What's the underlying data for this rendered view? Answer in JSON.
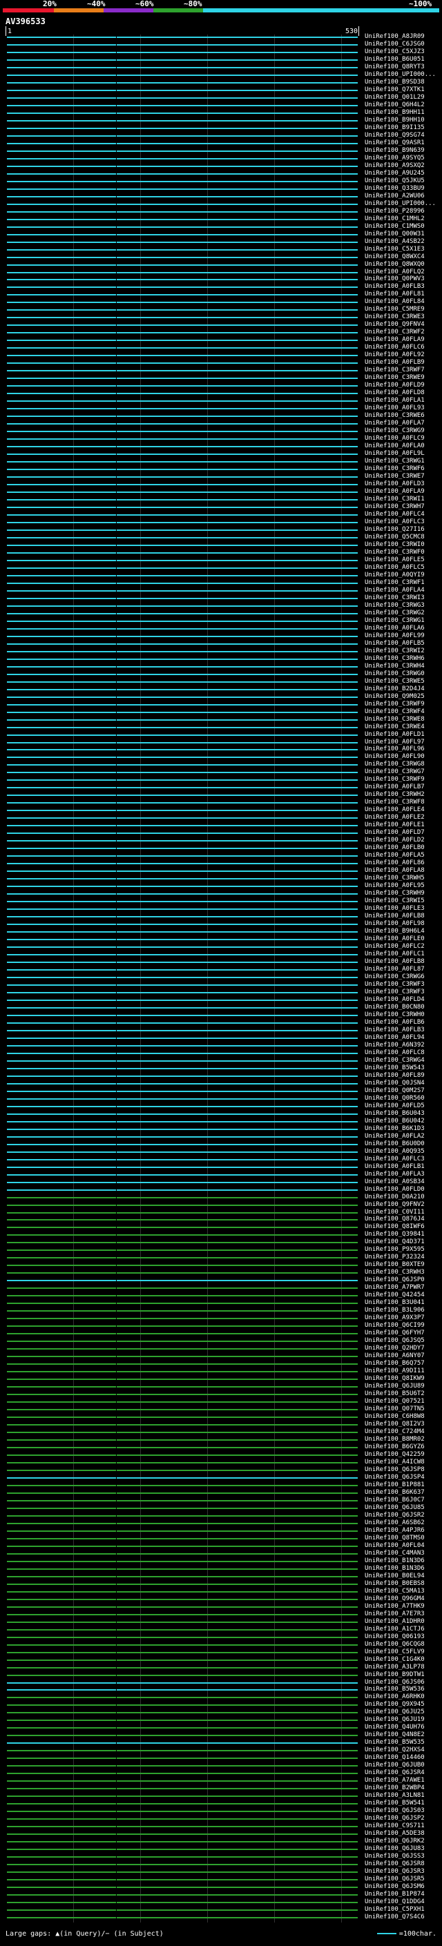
{
  "legend": {
    "thresholds": [
      "20%",
      "~40%",
      "~60%",
      "~80%",
      "~100%"
    ],
    "colors": [
      "#e8172e",
      "#e87e1a",
      "#8a2bc9",
      "#2ea22e",
      "#2fd4e6"
    ]
  },
  "query_id": "AV396533",
  "ruler": {
    "start": "1",
    "end": "530"
  },
  "colors": {
    "cyan": "#2fd4e6",
    "green": "#2ea22e",
    "background": "#000000"
  },
  "hits": [
    {
      "label": "UniRef100_A8JR09",
      "color": "cyan"
    },
    {
      "label": "UniRef100_C6JSG0",
      "color": "cyan"
    },
    {
      "label": "UniRef100_C5XJZ3",
      "color": "cyan"
    },
    {
      "label": "UniRef100_B6U051",
      "color": "cyan"
    },
    {
      "label": "UniRef100_Q8RYT3",
      "color": "cyan"
    },
    {
      "label": "UniRef100_UPI000...",
      "color": "cyan"
    },
    {
      "label": "UniRef100_B9SD38",
      "color": "cyan"
    },
    {
      "label": "UniRef100_Q7XTK1",
      "color": "cyan"
    },
    {
      "label": "UniRef100_Q01L29",
      "color": "cyan"
    },
    {
      "label": "UniRef100_Q6H4L2",
      "color": "cyan"
    },
    {
      "label": "UniRef100_B9HH11",
      "color": "cyan"
    },
    {
      "label": "UniRef100_B9HH10",
      "color": "cyan"
    },
    {
      "label": "UniRef100_B9I135",
      "color": "cyan"
    },
    {
      "label": "UniRef100_Q9SG74",
      "color": "cyan"
    },
    {
      "label": "UniRef100_Q9ASR1",
      "color": "cyan"
    },
    {
      "label": "UniRef100_B9N639",
      "color": "cyan"
    },
    {
      "label": "UniRef100_A9SYQ5",
      "color": "cyan"
    },
    {
      "label": "UniRef100_A9SXQ2",
      "color": "cyan"
    },
    {
      "label": "UniRef100_A9U245",
      "color": "cyan"
    },
    {
      "label": "UniRef100_Q5JKU5",
      "color": "cyan"
    },
    {
      "label": "UniRef100_Q33BU9",
      "color": "cyan"
    },
    {
      "label": "UniRef100_A2WU06",
      "color": "cyan"
    },
    {
      "label": "UniRef100_UPI000...",
      "color": "cyan"
    },
    {
      "label": "UniRef100_P28996",
      "color": "cyan"
    },
    {
      "label": "UniRef100_C1MHL2",
      "color": "cyan"
    },
    {
      "label": "UniRef100_C1MWS0",
      "color": "cyan"
    },
    {
      "label": "UniRef100_Q00W31",
      "color": "cyan"
    },
    {
      "label": "UniRef100_A4SB22",
      "color": "cyan"
    },
    {
      "label": "UniRef100_C5X1E3",
      "color": "cyan"
    },
    {
      "label": "UniRef100_Q8WXC4",
      "color": "cyan"
    },
    {
      "label": "UniRef100_Q8WXQ0",
      "color": "cyan"
    },
    {
      "label": "UniRef100_A0FLQ2",
      "color": "cyan"
    },
    {
      "label": "UniRef100_Q0PWV3",
      "color": "cyan"
    },
    {
      "label": "UniRef100_A0FLB3",
      "color": "cyan"
    },
    {
      "label": "UniRef100_A0FL81",
      "color": "cyan"
    },
    {
      "label": "UniRef100_A0FL84",
      "color": "cyan"
    },
    {
      "label": "UniRef100_C5MRE9",
      "color": "cyan"
    },
    {
      "label": "UniRef100_C3RWE3",
      "color": "cyan"
    },
    {
      "label": "UniRef100_Q9FNV4",
      "color": "cyan"
    },
    {
      "label": "UniRef100_C3RWF2",
      "color": "cyan"
    },
    {
      "label": "UniRef100_A0FLA9",
      "color": "cyan"
    },
    {
      "label": "UniRef100_A0FLC6",
      "color": "cyan"
    },
    {
      "label": "UniRef100_A0FL92",
      "color": "cyan"
    },
    {
      "label": "UniRef100_A0FLB9",
      "color": "cyan"
    },
    {
      "label": "UniRef100_C3RWF7",
      "color": "cyan"
    },
    {
      "label": "UniRef100_C3RWE9",
      "color": "cyan"
    },
    {
      "label": "UniRef100_A0FLD9",
      "color": "cyan"
    },
    {
      "label": "UniRef100_A0FLD8",
      "color": "cyan"
    },
    {
      "label": "UniRef100_A0FLA1",
      "color": "cyan"
    },
    {
      "label": "UniRef100_A0FL93",
      "color": "cyan"
    },
    {
      "label": "UniRef100_C3RWE6",
      "color": "cyan"
    },
    {
      "label": "UniRef100_A0FLA7",
      "color": "cyan"
    },
    {
      "label": "UniRef100_C3RWG9",
      "color": "cyan"
    },
    {
      "label": "UniRef100_A0FLC9",
      "color": "cyan"
    },
    {
      "label": "UniRef100_A0FLA0",
      "color": "cyan"
    },
    {
      "label": "UniRef100_A0FL9L",
      "color": "cyan"
    },
    {
      "label": "UniRef100_C3RWG1",
      "color": "cyan"
    },
    {
      "label": "UniRef100_C3RWF6",
      "color": "cyan"
    },
    {
      "label": "UniRef100_C3RWE7",
      "color": "cyan"
    },
    {
      "label": "UniRef100_A0FLD3",
      "color": "cyan"
    },
    {
      "label": "UniRef100_A0FLA9",
      "color": "cyan"
    },
    {
      "label": "UniRef100_C3RWI1",
      "color": "cyan"
    },
    {
      "label": "UniRef100_C3RWH7",
      "color": "cyan"
    },
    {
      "label": "UniRef100_A0FLC4",
      "color": "cyan"
    },
    {
      "label": "UniRef100_A0FLC3",
      "color": "cyan"
    },
    {
      "label": "UniRef100_Q27I16",
      "color": "cyan"
    },
    {
      "label": "UniRef100_Q5CMC8",
      "color": "cyan"
    },
    {
      "label": "UniRef100_C3RWI0",
      "color": "cyan"
    },
    {
      "label": "UniRef100_C3RWF0",
      "color": "cyan"
    },
    {
      "label": "UniRef100_A0FLE5",
      "color": "cyan"
    },
    {
      "label": "UniRef100_A0FLC5",
      "color": "cyan"
    },
    {
      "label": "UniRef100_A0QYI9",
      "color": "cyan"
    },
    {
      "label": "UniRef100_C3RWF1",
      "color": "cyan"
    },
    {
      "label": "UniRef100_A0FLA4",
      "color": "cyan"
    },
    {
      "label": "UniRef100_C3RWI3",
      "color": "cyan"
    },
    {
      "label": "UniRef100_C3RWG3",
      "color": "cyan"
    },
    {
      "label": "UniRef100_C3RWG2",
      "color": "cyan"
    },
    {
      "label": "UniRef100_C3RWG1",
      "color": "cyan"
    },
    {
      "label": "UniRef100_A0FLA6",
      "color": "cyan"
    },
    {
      "label": "UniRef100_A0FL99",
      "color": "cyan"
    },
    {
      "label": "UniRef100_A0FLB5",
      "color": "cyan"
    },
    {
      "label": "UniRef100_C3RWI2",
      "color": "cyan"
    },
    {
      "label": "UniRef100_C3RWH6",
      "color": "cyan"
    },
    {
      "label": "UniRef100_C3RWH4",
      "color": "cyan"
    },
    {
      "label": "UniRef100_C3RWG0",
      "color": "cyan"
    },
    {
      "label": "UniRef100_C3RWE5",
      "color": "cyan"
    },
    {
      "label": "UniRef100_B2D4J4",
      "color": "cyan"
    },
    {
      "label": "UniRef100_Q9M025",
      "color": "cyan"
    },
    {
      "label": "UniRef100_C3RWF9",
      "color": "cyan"
    },
    {
      "label": "UniRef100_C3RWF4",
      "color": "cyan"
    },
    {
      "label": "UniRef100_C3RWE8",
      "color": "cyan"
    },
    {
      "label": "UniRef100_C3RWE4",
      "color": "cyan"
    },
    {
      "label": "UniRef100_A0FLD1",
      "color": "cyan"
    },
    {
      "label": "UniRef100_A0FL97",
      "color": "cyan"
    },
    {
      "label": "UniRef100_A0FL96",
      "color": "cyan"
    },
    {
      "label": "UniRef100_A0FL90",
      "color": "cyan"
    },
    {
      "label": "UniRef100_C3RWG8",
      "color": "cyan"
    },
    {
      "label": "UniRef100_C3RWG7",
      "color": "cyan"
    },
    {
      "label": "UniRef100_C3RWF9",
      "color": "cyan"
    },
    {
      "label": "UniRef100_A0FLB7",
      "color": "cyan"
    },
    {
      "label": "UniRef100_C3RWH2",
      "color": "cyan"
    },
    {
      "label": "UniRef100_C3RWF8",
      "color": "cyan"
    },
    {
      "label": "UniRef100_A0FLE4",
      "color": "cyan"
    },
    {
      "label": "UniRef100_A0FLE2",
      "color": "cyan"
    },
    {
      "label": "UniRef100_A0FLE1",
      "color": "cyan"
    },
    {
      "label": "UniRef100_A0FLD7",
      "color": "cyan"
    },
    {
      "label": "UniRef100_A0FLD2",
      "color": "cyan"
    },
    {
      "label": "UniRef100_A0FLB0",
      "color": "cyan"
    },
    {
      "label": "UniRef100_A0FLA5",
      "color": "cyan"
    },
    {
      "label": "UniRef100_A0FL86",
      "color": "cyan"
    },
    {
      "label": "UniRef100_A0FLA8",
      "color": "cyan"
    },
    {
      "label": "UniRef100_C3RWH5",
      "color": "cyan"
    },
    {
      "label": "UniRef100_A0FL95",
      "color": "cyan"
    },
    {
      "label": "UniRef100_C3RWH9",
      "color": "cyan"
    },
    {
      "label": "UniRef100_C3RWI5",
      "color": "cyan"
    },
    {
      "label": "UniRef100_A0FLE3",
      "color": "cyan"
    },
    {
      "label": "UniRef100_A0FLB8",
      "color": "cyan"
    },
    {
      "label": "UniRef100_A0FL98",
      "color": "cyan"
    },
    {
      "label": "UniRef100_B9H6L4",
      "color": "cyan"
    },
    {
      "label": "UniRef100_A0FLE0",
      "color": "cyan"
    },
    {
      "label": "UniRef100_A0FLC2",
      "color": "cyan"
    },
    {
      "label": "UniRef100_A0FLC1",
      "color": "cyan"
    },
    {
      "label": "UniRef100_A0FLB8",
      "color": "cyan"
    },
    {
      "label": "UniRef100_A0FL87",
      "color": "cyan"
    },
    {
      "label": "UniRef100_C3RWG6",
      "color": "cyan"
    },
    {
      "label": "UniRef100_C3RWF3",
      "color": "cyan"
    },
    {
      "label": "UniRef100_C3RWF3",
      "color": "cyan"
    },
    {
      "label": "UniRef100_A0FLD4",
      "color": "cyan"
    },
    {
      "label": "UniRef100_B0CN80",
      "color": "cyan"
    },
    {
      "label": "UniRef100_C3RWH0",
      "color": "cyan"
    },
    {
      "label": "UniRef100_A0FLB6",
      "color": "cyan"
    },
    {
      "label": "UniRef100_A0FLB3",
      "color": "cyan"
    },
    {
      "label": "UniRef100_A0FL94",
      "color": "cyan"
    },
    {
      "label": "UniRef100_A6N392",
      "color": "cyan"
    },
    {
      "label": "UniRef100_A0FLC8",
      "color": "cyan"
    },
    {
      "label": "UniRef100_C3RWG4",
      "color": "cyan"
    },
    {
      "label": "UniRef100_B5W543",
      "color": "cyan"
    },
    {
      "label": "UniRef100_A0FL89",
      "color": "cyan"
    },
    {
      "label": "UniRef100_Q0JSN4",
      "color": "cyan"
    },
    {
      "label": "UniRef100_Q0M2S7",
      "color": "cyan"
    },
    {
      "label": "UniRef100_Q0R560",
      "color": "cyan"
    },
    {
      "label": "UniRef100_A0FLD5",
      "color": "cyan"
    },
    {
      "label": "UniRef100_B6U043",
      "color": "cyan"
    },
    {
      "label": "UniRef100_B6U042",
      "color": "cyan"
    },
    {
      "label": "UniRef100_B6K1D3",
      "color": "cyan"
    },
    {
      "label": "UniRef100_A0FLA2",
      "color": "cyan"
    },
    {
      "label": "UniRef100_B6U0D0",
      "color": "cyan"
    },
    {
      "label": "UniRef100_A0Q935",
      "color": "cyan"
    },
    {
      "label": "UniRef100_A0FLC3",
      "color": "cyan"
    },
    {
      "label": "UniRef100_A0FLB1",
      "color": "cyan"
    },
    {
      "label": "UniRef100_A0FLA3",
      "color": "cyan"
    },
    {
      "label": "UniRef100_A0SB34",
      "color": "cyan"
    },
    {
      "label": "UniRef100_A0FLD0",
      "color": "cyan"
    },
    {
      "label": "UniRef100_D0A210",
      "color": "green"
    },
    {
      "label": "UniRef100_Q9FNV2",
      "color": "green"
    },
    {
      "label": "UniRef100_C0VI11",
      "color": "green"
    },
    {
      "label": "UniRef100_Q876J4",
      "color": "green"
    },
    {
      "label": "UniRef100_Q8IWF6",
      "color": "green"
    },
    {
      "label": "UniRef100_Q39841",
      "color": "green"
    },
    {
      "label": "UniRef100_Q4D371",
      "color": "green"
    },
    {
      "label": "UniRef100_P9X595",
      "color": "green"
    },
    {
      "label": "UniRef100_P32324",
      "color": "green"
    },
    {
      "label": "UniRef100_B0XTE9",
      "color": "green"
    },
    {
      "label": "UniRef100_C3RWH3",
      "color": "green"
    },
    {
      "label": "UniRef100_Q6JSP0",
      "color": "cyan"
    },
    {
      "label": "UniRef100_A7PWR7",
      "color": "green"
    },
    {
      "label": "UniRef100_Q42454",
      "color": "green"
    },
    {
      "label": "UniRef100_B3U041",
      "color": "green"
    },
    {
      "label": "UniRef100_B3L906",
      "color": "green"
    },
    {
      "label": "UniRef100_A9X3P7",
      "color": "green"
    },
    {
      "label": "UniRef100_Q6CI99",
      "color": "green"
    },
    {
      "label": "UniRef100_Q6FYH7",
      "color": "green"
    },
    {
      "label": "UniRef100_Q6JSQ5",
      "color": "green"
    },
    {
      "label": "UniRef100_Q2HDY7",
      "color": "green"
    },
    {
      "label": "UniRef100_A6NY07",
      "color": "green"
    },
    {
      "label": "UniRef100_B6Q757",
      "color": "green"
    },
    {
      "label": "UniRef100_A9DI11",
      "color": "green"
    },
    {
      "label": "UniRef100_Q8IKW9",
      "color": "green"
    },
    {
      "label": "UniRef100_Q6JU89",
      "color": "green"
    },
    {
      "label": "UniRef100_B5U6T2",
      "color": "green"
    },
    {
      "label": "UniRef100_Q07521",
      "color": "green"
    },
    {
      "label": "UniRef100_Q07TN5",
      "color": "green"
    },
    {
      "label": "UniRef100_C6H8W8",
      "color": "green"
    },
    {
      "label": "UniRef100_Q8I2V3",
      "color": "green"
    },
    {
      "label": "UniRef100_C724M4",
      "color": "green"
    },
    {
      "label": "UniRef100_B8MR02",
      "color": "green"
    },
    {
      "label": "UniRef100_B6GYZ6",
      "color": "green"
    },
    {
      "label": "UniRef100_Q42259",
      "color": "green"
    },
    {
      "label": "UniRef100_A4ICW8",
      "color": "green"
    },
    {
      "label": "UniRef100_Q6JSP8",
      "color": "green"
    },
    {
      "label": "UniRef100_Q6JSP4",
      "color": "cyan"
    },
    {
      "label": "UniRef100_B1P881",
      "color": "green"
    },
    {
      "label": "UniRef100_B6K637",
      "color": "green"
    },
    {
      "label": "UniRef100_B6J0C7",
      "color": "green"
    },
    {
      "label": "UniRef100_Q6JU85",
      "color": "green"
    },
    {
      "label": "UniRef100_Q6JSR2",
      "color": "green"
    },
    {
      "label": "UniRef100_A6SB62",
      "color": "green"
    },
    {
      "label": "UniRef100_A4PJR6",
      "color": "green"
    },
    {
      "label": "UniRef100_Q8TMS0",
      "color": "green"
    },
    {
      "label": "UniRef100_A0FL04",
      "color": "green"
    },
    {
      "label": "UniRef100_C4MAN3",
      "color": "green"
    },
    {
      "label": "UniRef100_B1N3D6",
      "color": "green"
    },
    {
      "label": "UniRef100_B1N3D6",
      "color": "green"
    },
    {
      "label": "UniRef100_B0EL94",
      "color": "green"
    },
    {
      "label": "UniRef100_B0EBS8",
      "color": "green"
    },
    {
      "label": "UniRef100_C5MA13",
      "color": "green"
    },
    {
      "label": "UniRef100_Q96GM4",
      "color": "green"
    },
    {
      "label": "UniRef100_A7THK9",
      "color": "green"
    },
    {
      "label": "UniRef100_A7E7R3",
      "color": "green"
    },
    {
      "label": "UniRef100_A1DHR0",
      "color": "green"
    },
    {
      "label": "UniRef100_A1CTJ6",
      "color": "green"
    },
    {
      "label": "UniRef100_Q06193",
      "color": "green"
    },
    {
      "label": "UniRef100_Q6CQG8",
      "color": "green"
    },
    {
      "label": "UniRef100_C5FLV9",
      "color": "green"
    },
    {
      "label": "UniRef100_C1G4K0",
      "color": "green"
    },
    {
      "label": "UniRef100_A3LP78",
      "color": "green"
    },
    {
      "label": "UniRef100_B9DTW1",
      "color": "green"
    },
    {
      "label": "UniRef100_Q6JS06",
      "color": "cyan"
    },
    {
      "label": "UniRef100_B5W536",
      "color": "cyan"
    },
    {
      "label": "UniRef100_A6RHK0",
      "color": "green"
    },
    {
      "label": "UniRef100_Q9X945",
      "color": "green"
    },
    {
      "label": "UniRef100_Q6JU25",
      "color": "green"
    },
    {
      "label": "UniRef100_Q6JU19",
      "color": "green"
    },
    {
      "label": "UniRef100_Q4UH76",
      "color": "green"
    },
    {
      "label": "UniRef100_Q4N8E2",
      "color": "green"
    },
    {
      "label": "UniRef100_B5W535",
      "color": "cyan"
    },
    {
      "label": "UniRef100_Q2HXS4",
      "color": "green"
    },
    {
      "label": "UniRef100_Q14460",
      "color": "green"
    },
    {
      "label": "UniRef100_Q6JUB0",
      "color": "green"
    },
    {
      "label": "UniRef100_Q6JSR4",
      "color": "green"
    },
    {
      "label": "UniRef100_A7AWE1",
      "color": "green"
    },
    {
      "label": "UniRef100_B2WBP4",
      "color": "green"
    },
    {
      "label": "UniRef100_A3LN81",
      "color": "green"
    },
    {
      "label": "UniRef100_B5W541",
      "color": "green"
    },
    {
      "label": "UniRef100_Q6JS03",
      "color": "green"
    },
    {
      "label": "UniRef100_Q6JSP2",
      "color": "green"
    },
    {
      "label": "UniRef100_C9S711",
      "color": "green"
    },
    {
      "label": "UniRef100_A5DE38",
      "color": "green"
    },
    {
      "label": "UniRef100_Q6JRK2",
      "color": "green"
    },
    {
      "label": "UniRef100_Q6JU83",
      "color": "green"
    },
    {
      "label": "UniRef100_Q6JSS3",
      "color": "green"
    },
    {
      "label": "UniRef100_Q6JSR8",
      "color": "green"
    },
    {
      "label": "UniRef100_Q6JSR3",
      "color": "green"
    },
    {
      "label": "UniRef100_Q6JSR5",
      "color": "green"
    },
    {
      "label": "UniRef100_Q6JSM6",
      "color": "green"
    },
    {
      "label": "UniRef100_B1P874",
      "color": "green"
    },
    {
      "label": "UniRef100_Q1DDG4",
      "color": "green"
    },
    {
      "label": "UniRef100_C5PXH1",
      "color": "green"
    },
    {
      "label": "UniRef100_Q7S4C6",
      "color": "green"
    }
  ],
  "footer": {
    "large_gaps": "Large gaps: ▲(in Query)/− (in Subject)",
    "scale": "=100char."
  }
}
